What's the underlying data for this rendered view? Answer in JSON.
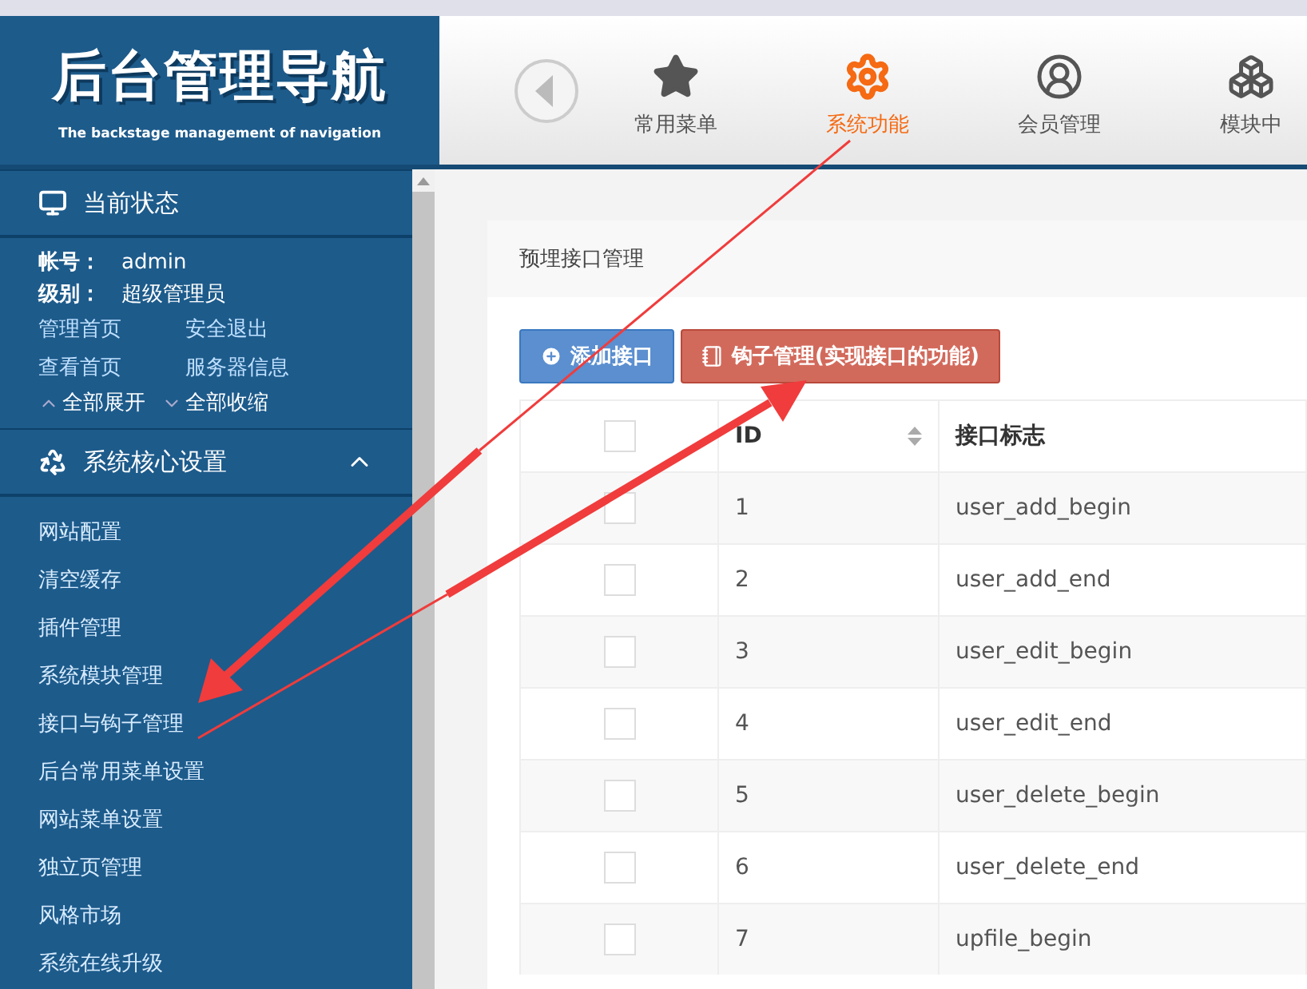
{
  "header": {
    "logo_title": "后台管理导航",
    "logo_subtitle": "The backstage management of navigation",
    "nav_items": [
      {
        "kind": "star",
        "label": "常用菜单",
        "selected": false
      },
      {
        "kind": "gear",
        "label": "系统功能",
        "selected": true
      },
      {
        "kind": "user",
        "label": "会员管理",
        "selected": false
      },
      {
        "kind": "cubes",
        "label": "模块中",
        "selected": false
      }
    ]
  },
  "sidebar": {
    "status": {
      "title": "当前状态",
      "fields": [
        {
          "label": "帐号：",
          "value": "admin"
        },
        {
          "label": "级别：",
          "value": "超级管理员"
        }
      ],
      "links": [
        [
          "管理首页",
          "安全退出"
        ],
        [
          "查看首页",
          "服务器信息"
        ]
      ],
      "expand_all": "全部展开",
      "collapse_all": "全部收缩"
    },
    "section": {
      "title": "系统核心设置",
      "expanded": true,
      "items": [
        "网站配置",
        "清空缓存",
        "插件管理",
        "系统模块管理",
        "接口与钩子管理",
        "后台常用菜单设置",
        "网站菜单设置",
        "独立页管理",
        "风格市场",
        "系统在线升级"
      ]
    }
  },
  "panel": {
    "title": "预埋接口管理",
    "buttons": [
      {
        "kind": "add",
        "label": "添加接口"
      },
      {
        "kind": "hook",
        "label": "钩子管理(实现接口的功能)"
      }
    ],
    "table": {
      "select_all_checked": false,
      "columns": [
        "ID",
        "接口标志"
      ],
      "rows": [
        {
          "checked": false,
          "cells": [
            "1",
            "user_add_begin"
          ]
        },
        {
          "checked": false,
          "cells": [
            "2",
            "user_add_end"
          ]
        },
        {
          "checked": false,
          "cells": [
            "3",
            "user_edit_begin"
          ]
        },
        {
          "checked": false,
          "cells": [
            "4",
            "user_edit_end"
          ]
        },
        {
          "checked": false,
          "cells": [
            "5",
            "user_delete_begin"
          ]
        },
        {
          "checked": false,
          "cells": [
            "6",
            "user_delete_end"
          ]
        },
        {
          "checked": false,
          "cells": [
            "7",
            "upfile_begin"
          ]
        }
      ]
    }
  }
}
